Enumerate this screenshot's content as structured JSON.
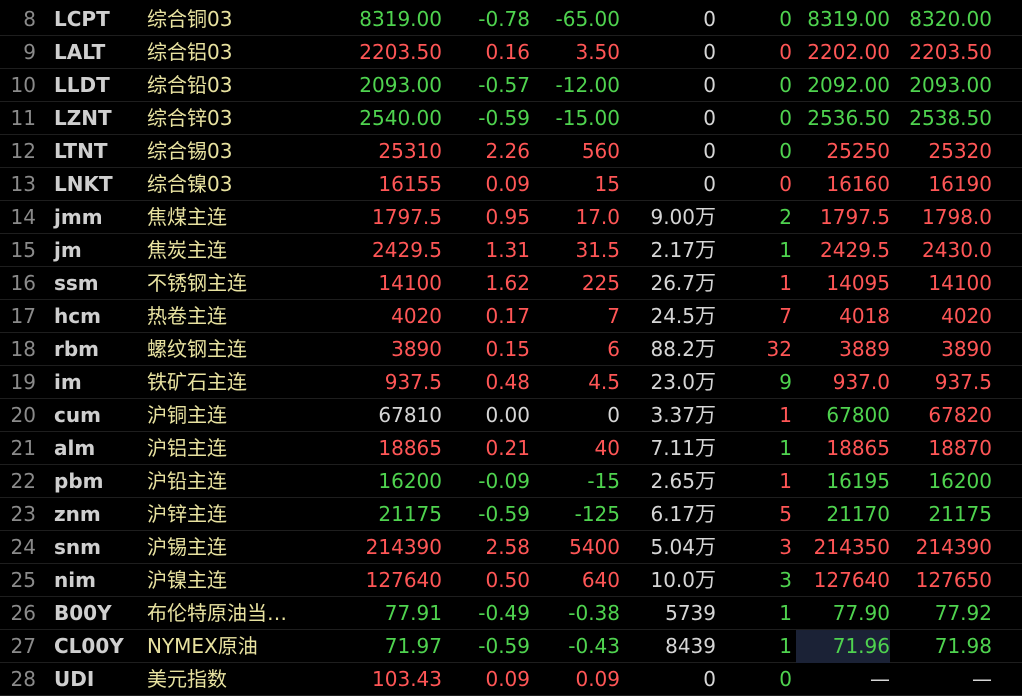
{
  "colors": {
    "up": "#ff5656",
    "down": "#4fd34f",
    "flat": "#d6d6d6",
    "name": "#e8e2a0",
    "background": "#000000"
  },
  "rows": [
    {
      "idx": "8",
      "code": "LCPT",
      "name": "综合铜03",
      "last": "8319.00",
      "chg_pct": "-0.78",
      "chg": "-65.00",
      "vol": "0",
      "vol_unit": "",
      "cur": "0",
      "bid": "8319.00",
      "ask": "8320.00",
      "dir": "down",
      "cur_dir": "down",
      "bid_dir": "down",
      "ask_dir": "down"
    },
    {
      "idx": "9",
      "code": "LALT",
      "name": "综合铝03",
      "last": "2203.50",
      "chg_pct": "0.16",
      "chg": "3.50",
      "vol": "0",
      "vol_unit": "",
      "cur": "0",
      "bid": "2202.00",
      "ask": "2203.50",
      "dir": "up",
      "cur_dir": "up",
      "bid_dir": "up",
      "ask_dir": "up"
    },
    {
      "idx": "10",
      "code": "LLDT",
      "name": "综合铅03",
      "last": "2093.00",
      "chg_pct": "-0.57",
      "chg": "-12.00",
      "vol": "0",
      "vol_unit": "",
      "cur": "0",
      "bid": "2092.00",
      "ask": "2093.00",
      "dir": "down",
      "cur_dir": "down",
      "bid_dir": "down",
      "ask_dir": "down"
    },
    {
      "idx": "11",
      "code": "LZNT",
      "name": "综合锌03",
      "last": "2540.00",
      "chg_pct": "-0.59",
      "chg": "-15.00",
      "vol": "0",
      "vol_unit": "",
      "cur": "0",
      "bid": "2536.50",
      "ask": "2538.50",
      "dir": "down",
      "cur_dir": "down",
      "bid_dir": "down",
      "ask_dir": "down"
    },
    {
      "idx": "12",
      "code": "LTNT",
      "name": "综合锡03",
      "last": "25310",
      "chg_pct": "2.26",
      "chg": "560",
      "vol": "0",
      "vol_unit": "",
      "cur": "0",
      "bid": "25250",
      "ask": "25320",
      "dir": "up",
      "cur_dir": "down",
      "bid_dir": "up",
      "ask_dir": "up"
    },
    {
      "idx": "13",
      "code": "LNKT",
      "name": "综合镍03",
      "last": "16155",
      "chg_pct": "0.09",
      "chg": "15",
      "vol": "0",
      "vol_unit": "",
      "cur": "0",
      "bid": "16160",
      "ask": "16190",
      "dir": "up",
      "cur_dir": "up",
      "bid_dir": "up",
      "ask_dir": "up"
    },
    {
      "idx": "14",
      "code": "jmm",
      "name": "焦煤主连",
      "last": "1797.5",
      "chg_pct": "0.95",
      "chg": "17.0",
      "vol": "9.00",
      "vol_unit": "万",
      "cur": "2",
      "bid": "1797.5",
      "ask": "1798.0",
      "dir": "up",
      "cur_dir": "down",
      "bid_dir": "up",
      "ask_dir": "up"
    },
    {
      "idx": "15",
      "code": "jm",
      "name": "焦炭主连",
      "last": "2429.5",
      "chg_pct": "1.31",
      "chg": "31.5",
      "vol": "2.17",
      "vol_unit": "万",
      "cur": "1",
      "bid": "2429.5",
      "ask": "2430.0",
      "dir": "up",
      "cur_dir": "down",
      "bid_dir": "up",
      "ask_dir": "up"
    },
    {
      "idx": "16",
      "code": "ssm",
      "name": "不锈钢主连",
      "last": "14100",
      "chg_pct": "1.62",
      "chg": "225",
      "vol": "26.7",
      "vol_unit": "万",
      "cur": "1",
      "bid": "14095",
      "ask": "14100",
      "dir": "up",
      "cur_dir": "up",
      "bid_dir": "up",
      "ask_dir": "up"
    },
    {
      "idx": "17",
      "code": "hcm",
      "name": "热卷主连",
      "last": "4020",
      "chg_pct": "0.17",
      "chg": "7",
      "vol": "24.5",
      "vol_unit": "万",
      "cur": "7",
      "bid": "4018",
      "ask": "4020",
      "dir": "up",
      "cur_dir": "up",
      "bid_dir": "up",
      "ask_dir": "up"
    },
    {
      "idx": "18",
      "code": "rbm",
      "name": "螺纹钢主连",
      "last": "3890",
      "chg_pct": "0.15",
      "chg": "6",
      "vol": "88.2",
      "vol_unit": "万",
      "cur": "32",
      "bid": "3889",
      "ask": "3890",
      "dir": "up",
      "cur_dir": "up",
      "bid_dir": "up",
      "ask_dir": "up"
    },
    {
      "idx": "19",
      "code": "im",
      "name": "铁矿石主连",
      "last": "937.5",
      "chg_pct": "0.48",
      "chg": "4.5",
      "vol": "23.0",
      "vol_unit": "万",
      "cur": "9",
      "bid": "937.0",
      "ask": "937.5",
      "dir": "up",
      "cur_dir": "down",
      "bid_dir": "up",
      "ask_dir": "up"
    },
    {
      "idx": "20",
      "code": "cum",
      "name": "沪铜主连",
      "last": "67810",
      "chg_pct": "0.00",
      "chg": "0",
      "vol": "3.37",
      "vol_unit": "万",
      "cur": "1",
      "bid": "67800",
      "ask": "67820",
      "dir": "flat",
      "cur_dir": "up",
      "bid_dir": "down",
      "ask_dir": "up"
    },
    {
      "idx": "21",
      "code": "alm",
      "name": "沪铝主连",
      "last": "18865",
      "chg_pct": "0.21",
      "chg": "40",
      "vol": "7.11",
      "vol_unit": "万",
      "cur": "1",
      "bid": "18865",
      "ask": "18870",
      "dir": "up",
      "cur_dir": "down",
      "bid_dir": "up",
      "ask_dir": "up"
    },
    {
      "idx": "22",
      "code": "pbm",
      "name": "沪铅主连",
      "last": "16200",
      "chg_pct": "-0.09",
      "chg": "-15",
      "vol": "2.65",
      "vol_unit": "万",
      "cur": "1",
      "bid": "16195",
      "ask": "16200",
      "dir": "down",
      "cur_dir": "up",
      "bid_dir": "down",
      "ask_dir": "down"
    },
    {
      "idx": "23",
      "code": "znm",
      "name": "沪锌主连",
      "last": "21175",
      "chg_pct": "-0.59",
      "chg": "-125",
      "vol": "6.17",
      "vol_unit": "万",
      "cur": "5",
      "bid": "21170",
      "ask": "21175",
      "dir": "down",
      "cur_dir": "up",
      "bid_dir": "down",
      "ask_dir": "down"
    },
    {
      "idx": "24",
      "code": "snm",
      "name": "沪锡主连",
      "last": "214390",
      "chg_pct": "2.58",
      "chg": "5400",
      "vol": "5.04",
      "vol_unit": "万",
      "cur": "3",
      "bid": "214350",
      "ask": "214390",
      "dir": "up",
      "cur_dir": "up",
      "bid_dir": "up",
      "ask_dir": "up"
    },
    {
      "idx": "25",
      "code": "nim",
      "name": "沪镍主连",
      "last": "127640",
      "chg_pct": "0.50",
      "chg": "640",
      "vol": "10.0",
      "vol_unit": "万",
      "cur": "3",
      "bid": "127640",
      "ask": "127650",
      "dir": "up",
      "cur_dir": "down",
      "bid_dir": "up",
      "ask_dir": "up"
    },
    {
      "idx": "26",
      "code": "B00Y",
      "name": "布伦特原油当…",
      "last": "77.91",
      "chg_pct": "-0.49",
      "chg": "-0.38",
      "vol": "5739",
      "vol_unit": "",
      "cur": "1",
      "bid": "77.90",
      "ask": "77.92",
      "dir": "down",
      "cur_dir": "down",
      "bid_dir": "down",
      "ask_dir": "down"
    },
    {
      "idx": "27",
      "code": "CL00Y",
      "name": "NYMEX原油",
      "last": "71.97",
      "chg_pct": "-0.59",
      "chg": "-0.43",
      "vol": "8439",
      "vol_unit": "",
      "cur": "1",
      "bid": "71.96",
      "ask": "71.98",
      "dir": "down",
      "cur_dir": "down",
      "bid_dir": "down",
      "ask_dir": "down",
      "bid_selected": true
    },
    {
      "idx": "28",
      "code": "UDI",
      "name": "美元指数",
      "last": "103.43",
      "chg_pct": "0.09",
      "chg": "0.09",
      "vol": "0",
      "vol_unit": "",
      "cur": "0",
      "bid": "—",
      "ask": "—",
      "dir": "up",
      "cur_dir": "down",
      "bid_dir": "flat",
      "ask_dir": "flat"
    }
  ]
}
